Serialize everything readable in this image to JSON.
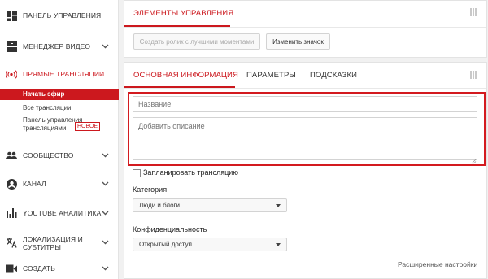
{
  "sidebar": {
    "items": [
      {
        "label": "ПАНЕЛЬ УПРАВЛЕНИЯ",
        "icon": "dashboard-icon"
      },
      {
        "label": "МЕНЕДЖЕР ВИДЕО",
        "icon": "video-manager-icon"
      },
      {
        "label": "ПРЯМЫЕ ТРАНСЛЯЦИИ",
        "icon": "live-broadcast-icon"
      },
      {
        "label": "СООБЩЕСТВО",
        "icon": "community-icon"
      },
      {
        "label": "КАНАЛ",
        "icon": "channel-icon"
      },
      {
        "label": "YOUTUBE АНАЛИТИКА",
        "icon": "analytics-icon"
      },
      {
        "label": "ЛОКАЛИЗАЦИЯ И",
        "label2": "СУБТИТРЫ",
        "icon": "translate-icon"
      },
      {
        "label": "СОЗДАТЬ",
        "icon": "create-video-icon"
      }
    ],
    "live_sub": {
      "start": "Начать эфир",
      "all": "Все трансляции",
      "panel_line1": "Панель управления",
      "panel_line2": "трансляциями",
      "new_badge": "НОВОЕ"
    }
  },
  "controls_card": {
    "tab": "ЭЛЕМЕНТЫ УПРАВЛЕНИЯ",
    "create_clip": "Создать ролик с лучшими моментами",
    "change_icon": "Изменить значок"
  },
  "info_card": {
    "tabs": [
      "ОСНОВНАЯ ИНФОРМАЦИЯ",
      "ПАРАМЕТРЫ",
      "ПОДСКАЗКИ"
    ],
    "title_placeholder": "Название",
    "description_placeholder": "Добавить описание",
    "schedule_label": "Запланировать трансляцию",
    "category_label": "Категория",
    "category_value": "Люди и блоги",
    "privacy_label": "Конфиденциальность",
    "privacy_value": "Открытый доступ",
    "advanced_link": "Расширенные настройки"
  },
  "colors": {
    "accent": "#cc181e",
    "highlight": "#d31a1f"
  }
}
